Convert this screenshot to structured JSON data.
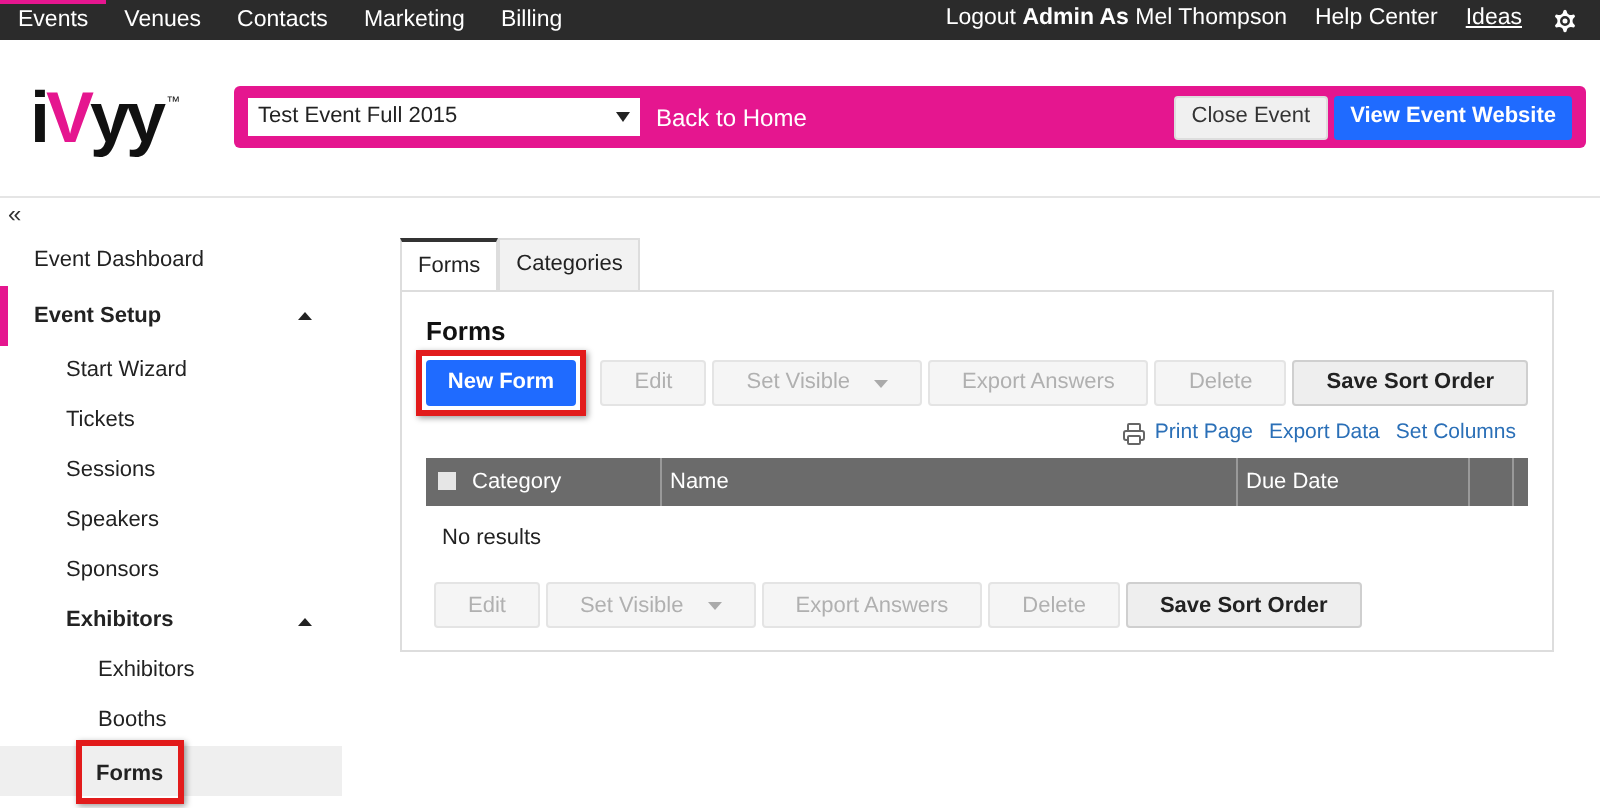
{
  "top_nav": {
    "items": [
      {
        "label": "Events",
        "selected": true
      },
      {
        "label": "Venues",
        "selected": false
      },
      {
        "label": "Contacts",
        "selected": false
      },
      {
        "label": "Marketing",
        "selected": false
      },
      {
        "label": "Billing",
        "selected": false
      }
    ],
    "account": "Logout **Admin As** Mel Thompson",
    "links": [
      {
        "label": "Help Center",
        "underlined": false
      },
      {
        "label": "Ideas",
        "underlined": true
      }
    ]
  },
  "logo": {
    "parts": [
      {
        "text": "i",
        "color": "#111111"
      },
      {
        "text": "V",
        "color": "#e5168f"
      },
      {
        "text": "yy",
        "color": "#111111"
      }
    ],
    "mark": "™"
  },
  "event_bar": {
    "event_select": "Test Event Full 2015",
    "back_link": "Back to Home",
    "buttons": [
      {
        "label": "Close Event",
        "kind": "secondary"
      },
      {
        "label": "View Event Website",
        "kind": "primary"
      }
    ]
  },
  "sidebar": {
    "collapse": "«",
    "items": [
      {
        "label": "Event Dashboard",
        "bold": false,
        "selected": false,
        "active": false
      },
      {
        "label": "Event Setup",
        "bold": true,
        "selected": false,
        "active": true,
        "expanded": true,
        "children": [
          {
            "label": "Start Wizard",
            "bold": false,
            "selected": false
          },
          {
            "label": "Tickets",
            "bold": false,
            "selected": false
          },
          {
            "label": "Sessions",
            "bold": false,
            "selected": false
          },
          {
            "label": "Speakers",
            "bold": false,
            "selected": false
          },
          {
            "label": "Sponsors",
            "bold": false,
            "selected": false
          },
          {
            "label": "Exhibitors",
            "bold": true,
            "selected": false,
            "expanded": true,
            "children": [
              {
                "label": "Exhibitors",
                "bold": false,
                "selected": false
              },
              {
                "label": "Booths",
                "bold": false,
                "selected": false
              },
              {
                "label": "Forms",
                "bold": true,
                "selected": true,
                "highlighted": true
              }
            ]
          }
        ]
      }
    ]
  },
  "tabs": [
    {
      "label": "Forms",
      "selected": true
    },
    {
      "label": "Categories",
      "selected": false
    }
  ],
  "panel": {
    "title": "Forms",
    "toolbar": [
      {
        "label": "New Form",
        "kind": "primary",
        "disabled": false,
        "highlighted": true
      },
      {
        "label": "Edit",
        "kind": "plain",
        "disabled": true
      },
      {
        "label": "Set Visible",
        "kind": "dropdown",
        "disabled": true
      },
      {
        "label": "Export Answers",
        "kind": "plain",
        "disabled": true
      },
      {
        "label": "Delete",
        "kind": "plain",
        "disabled": true
      },
      {
        "label": "Save Sort Order",
        "kind": "plain",
        "disabled": false
      }
    ],
    "links": [
      {
        "label": "Print Page",
        "kind": "print"
      },
      {
        "label": "Export Data"
      },
      {
        "label": "Set Columns"
      }
    ],
    "table": {
      "select_all_checked": false,
      "columns": [
        "Category",
        "Name",
        "Due Date"
      ],
      "empty_text": "No results"
    },
    "bottom_toolbar": [
      {
        "label": "Edit",
        "kind": "plain",
        "disabled": true
      },
      {
        "label": "Set Visible",
        "kind": "dropdown",
        "disabled": true
      },
      {
        "label": "Export Answers",
        "kind": "plain",
        "disabled": true
      },
      {
        "label": "Delete",
        "kind": "plain",
        "disabled": true
      },
      {
        "label": "Save Sort Order",
        "kind": "plain",
        "disabled": false
      }
    ]
  }
}
